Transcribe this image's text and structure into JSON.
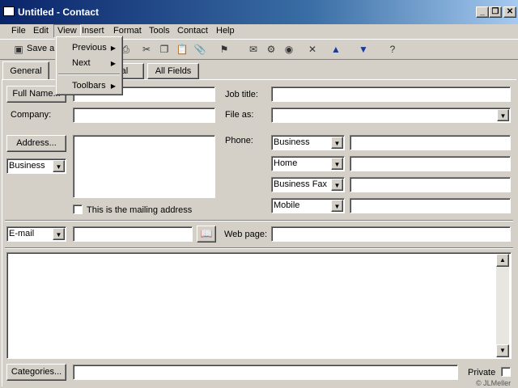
{
  "window": {
    "title": "Untitled - Contact"
  },
  "menubar": [
    "File",
    "Edit",
    "View",
    "Insert",
    "Format",
    "Tools",
    "Contact",
    "Help"
  ],
  "toolbar": {
    "save_label": "Save a"
  },
  "view_menu": {
    "items": [
      "Previous",
      "Next",
      "Toolbars"
    ]
  },
  "tabs": [
    "General",
    "rnal",
    "All Fields"
  ],
  "form": {
    "full_name_btn": "Full Name...",
    "company_label": "Company:",
    "job_title_label": "Job title:",
    "file_as_label": "File as:",
    "address_btn": "Address...",
    "address_type": "Business",
    "mailing_checkbox": "This is the mailing address",
    "phone_label": "Phone:",
    "phones": [
      "Business",
      "Home",
      "Business Fax",
      "Mobile"
    ],
    "email_type": "E-mail",
    "web_page_label": "Web page:",
    "categories_btn": "Categories...",
    "private_label": "Private"
  },
  "watermark": "© JLMeller"
}
